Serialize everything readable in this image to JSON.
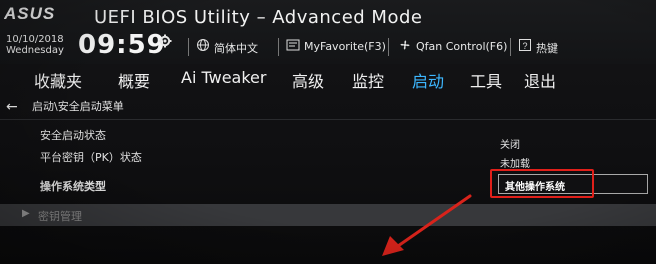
{
  "header": {
    "brand": "ASUS",
    "title": "UEFI BIOS Utility – Advanced Mode",
    "date": "10/10/2018",
    "weekday": "Wednesday",
    "time": "09:59",
    "language": "简体中文",
    "favorites": "MyFavorite(F3)",
    "qfan": "Qfan Control(F6)",
    "hotkeys": "热键"
  },
  "menu": {
    "items": [
      "收藏夹",
      "概要",
      "Ai Tweaker",
      "高级",
      "监控",
      "启动",
      "工具",
      "退出"
    ],
    "active": "启动"
  },
  "breadcrumb": "启动\\安全启动菜单",
  "settings": {
    "secure_boot_state": {
      "label": "安全启动状态",
      "value": "关闭"
    },
    "platform_key": {
      "label": "平台密钥（PK）状态",
      "value": "未加载"
    },
    "os_type": {
      "label": "操作系统类型",
      "value": "其他操作系统"
    }
  },
  "key_management": {
    "label": "密钥管理"
  },
  "colors": {
    "active_tab": "#3db7ff",
    "highlight": "#e0201a"
  }
}
